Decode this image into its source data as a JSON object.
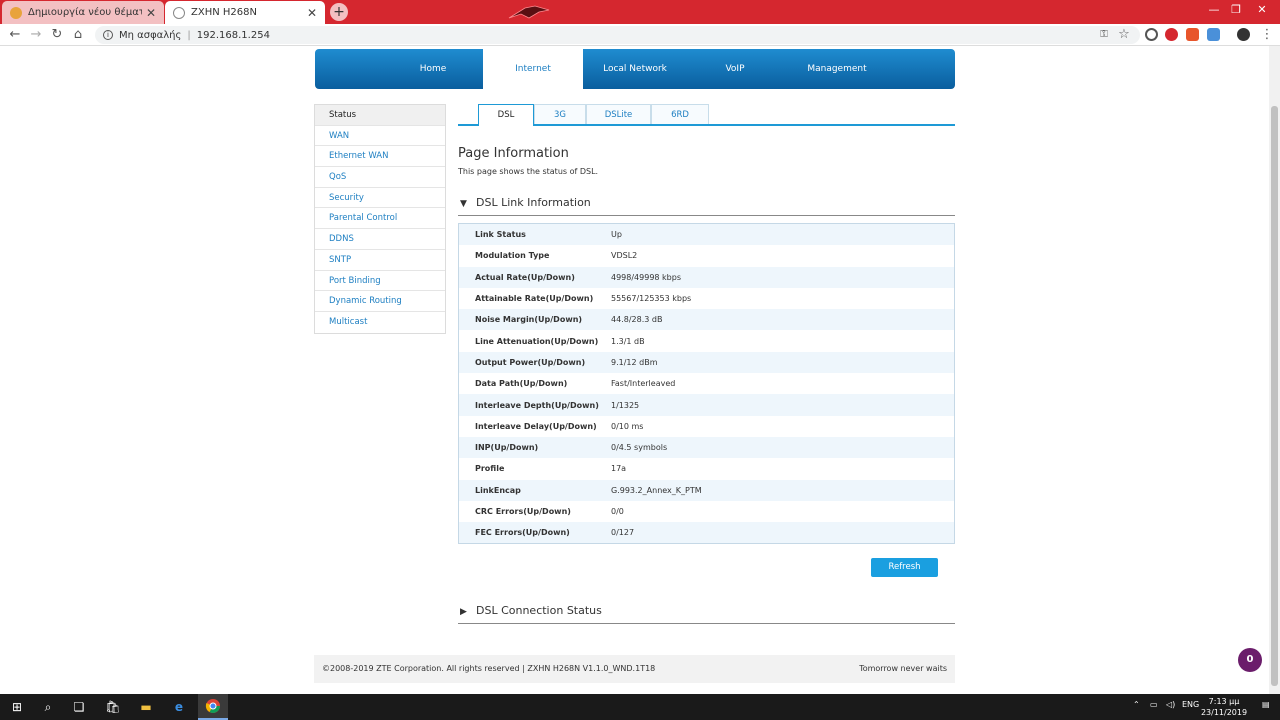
{
  "browser": {
    "tabs": [
      {
        "title": "Δημιουργία νέου θέματος - Insom",
        "active": false,
        "favicon": "forum-icon",
        "color": "#e8a33c"
      },
      {
        "title": "ZXHN H268N",
        "active": true,
        "favicon": "globe-icon",
        "color": "#888888"
      }
    ],
    "security_label": "Μη ασφαλής",
    "url": "192.168.1.254",
    "accent": "#d5272f"
  },
  "router": {
    "topnav": [
      "Home",
      "Internet",
      "Local Network",
      "VoIP",
      "Management"
    ],
    "topnav_active": "Internet",
    "sidebar": [
      "Status",
      "WAN",
      "Ethernet WAN",
      "QoS",
      "Security",
      "Parental Control",
      "DDNS",
      "SNTP",
      "Port Binding",
      "Dynamic Routing",
      "Multicast"
    ],
    "subtabs": [
      "DSL",
      "3G",
      "DSLite",
      "6RD"
    ],
    "subtab_active": "DSL",
    "page_title": "Page Information",
    "page_desc": "This page shows the status of DSL.",
    "section1_title": "DSL Link Information",
    "rows": [
      {
        "label": "Link Status",
        "value": "Up"
      },
      {
        "label": "Modulation Type",
        "value": "VDSL2"
      },
      {
        "label": "Actual Rate(Up/Down)",
        "value": "4998/49998 kbps"
      },
      {
        "label": "Attainable Rate(Up/Down)",
        "value": "55567/125353 kbps"
      },
      {
        "label": "Noise Margin(Up/Down)",
        "value": "44.8/28.3 dB"
      },
      {
        "label": "Line Attenuation(Up/Down)",
        "value": "1.3/1 dB"
      },
      {
        "label": "Output Power(Up/Down)",
        "value": "9.1/12 dBm"
      },
      {
        "label": "Data Path(Up/Down)",
        "value": "Fast/Interleaved"
      },
      {
        "label": "Interleave Depth(Up/Down)",
        "value": "1/1325"
      },
      {
        "label": "Interleave Delay(Up/Down)",
        "value": "0/10 ms"
      },
      {
        "label": "INP(Up/Down)",
        "value": "0/4.5 symbols"
      },
      {
        "label": "Profile",
        "value": "17a"
      },
      {
        "label": "LinkEncap",
        "value": "G.993.2_Annex_K_PTM"
      },
      {
        "label": "CRC Errors(Up/Down)",
        "value": "0/0"
      },
      {
        "label": "FEC Errors(Up/Down)",
        "value": "0/127"
      }
    ],
    "refresh_label": "Refresh",
    "section2_title": "DSL Connection Status",
    "footer_left": "©2008-2019 ZTE Corporation. All rights reserved  |  ZXHN H268N V1.1.0_WND.1T18",
    "footer_right": "Tomorrow never waits",
    "badge_count": "0"
  },
  "taskbar": {
    "language": "ENG",
    "time": "7:13 μμ",
    "date": "23/11/2019"
  }
}
